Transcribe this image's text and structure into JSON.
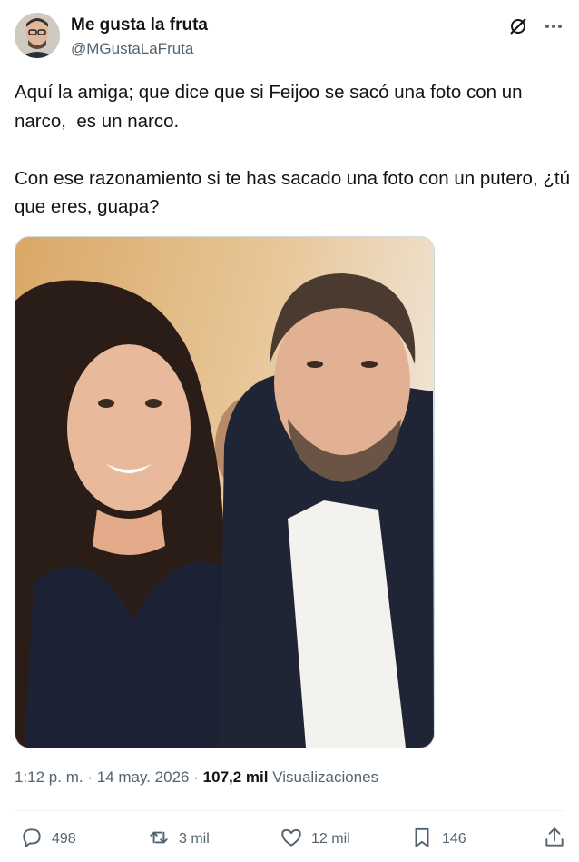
{
  "author": {
    "display_name": "Me gusta la fruta",
    "handle": "@MGustaLaFruta"
  },
  "header_icons": [
    "grok-icon",
    "more-icon"
  ],
  "tweet": {
    "text": "Aquí la amiga; que dice que si Feijoo se sacó una foto con un narco,  es un narco.\n\nCon ese razonamiento si te has sacado una foto con un putero, ¿tú que eres, guapa?"
  },
  "meta": {
    "time": "1:12 p. m.",
    "date": "14 may. 2026",
    "views_count": "107,2 mil",
    "views_label": "Visualizaciones",
    "separator": "·"
  },
  "actions": {
    "replies": "498",
    "reposts": "3 mil",
    "likes": "12 mil",
    "bookmarks": "146"
  },
  "colors": {
    "text_primary": "#0f1419",
    "text_secondary": "#536471",
    "divider": "#eff3f4"
  }
}
